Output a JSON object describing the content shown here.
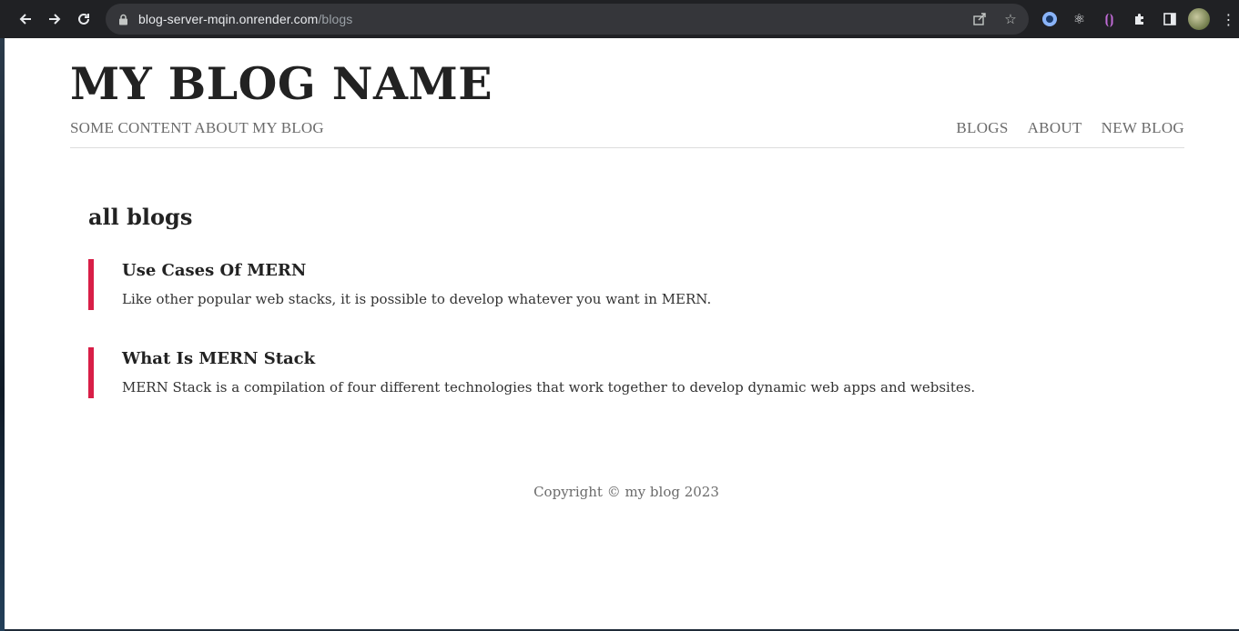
{
  "browser": {
    "url_host": "blog-server-mqin.onrender.com",
    "url_path": "/blogs",
    "icons": [
      "back-arrow-icon",
      "forward-arrow-icon",
      "reload-icon",
      "lock-icon",
      "share-icon",
      "star-icon",
      "extension-icon",
      "puzzle-icon",
      "sidepanel-icon",
      "kebab-menu-icon"
    ]
  },
  "header": {
    "title": "MY BLOG NAME",
    "subtitle": "SOME CONTENT ABOUT MY BLOG",
    "nav": [
      "BLOGS",
      "ABOUT",
      "NEW BLOG"
    ]
  },
  "main": {
    "heading": "all blogs",
    "blogs": [
      {
        "title": "Use Cases Of MERN",
        "snippet": "Like other popular web stacks, it is possible to develop whatever you want in MERN."
      },
      {
        "title": "What Is MERN Stack",
        "snippet": "MERN Stack is a compilation of four different technologies that work together to develop dynamic web apps and websites."
      }
    ]
  },
  "footer": {
    "text": "Copyright © my blog 2023"
  },
  "colors": {
    "accent": "#d81e47",
    "text": "#222222",
    "muted": "#6b6b6b",
    "chrome": "#202124"
  }
}
